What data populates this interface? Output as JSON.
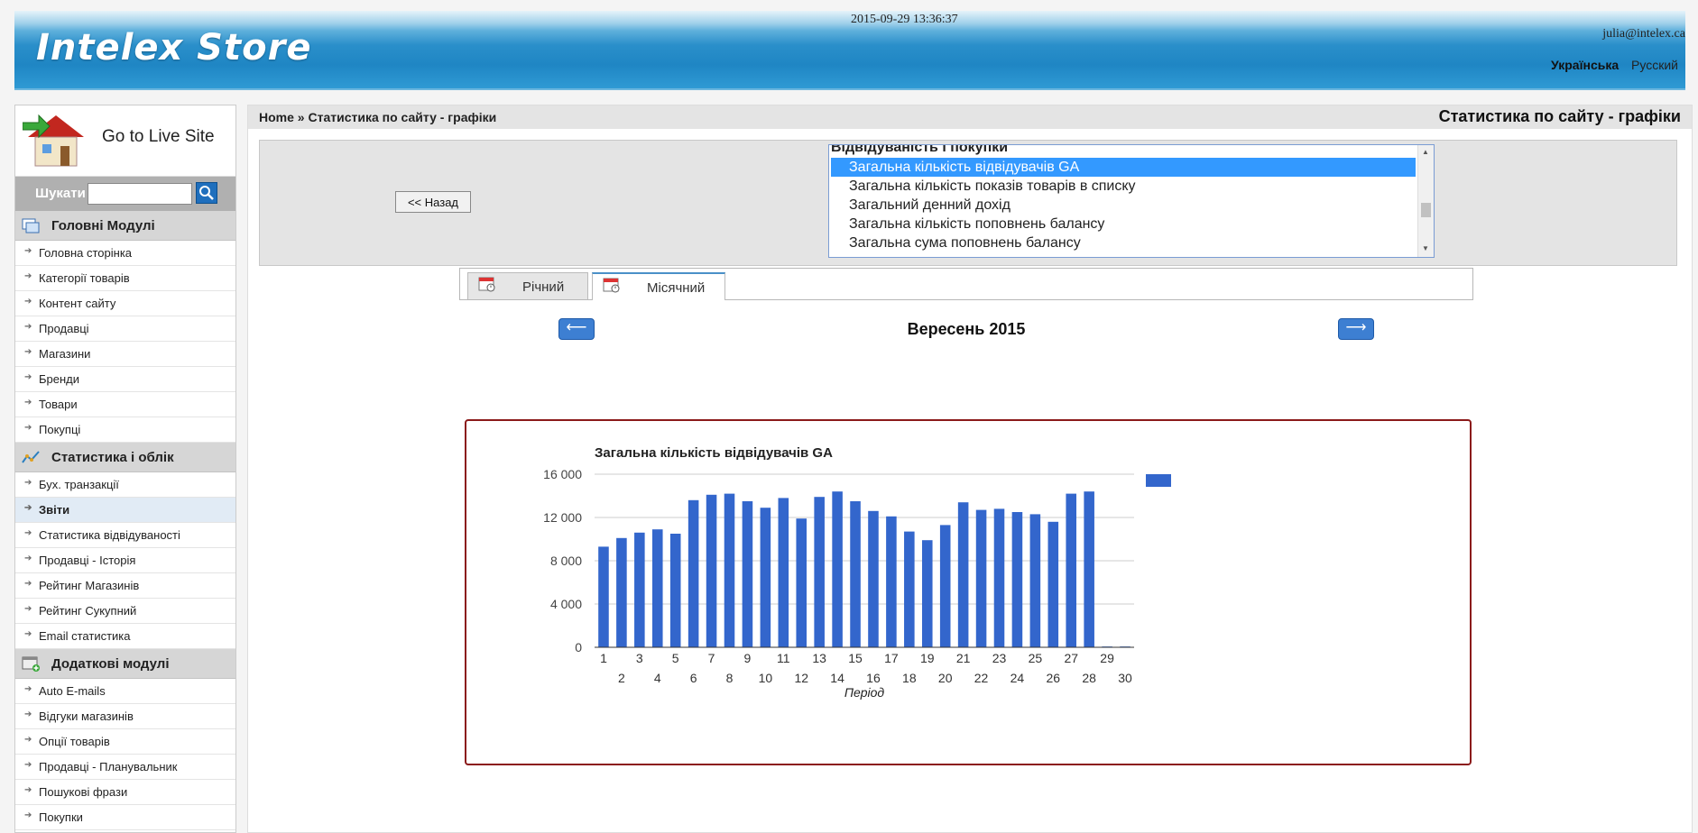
{
  "header": {
    "logo": "Intelex Store",
    "datetime": "2015-09-29 13:36:37",
    "user_email": "julia@intelex.ca",
    "languages": [
      "Українська",
      "Русский"
    ]
  },
  "sidebar": {
    "go_live": "Go to Live Site",
    "search_label": "Шукати",
    "search_value": "",
    "sections": [
      {
        "title": "Головні Модулі",
        "items": [
          "Головна сторінка",
          "Категорії товарів",
          "Контент сайту",
          "Продавці",
          "Магазини",
          "Бренди",
          "Товари",
          "Покупці"
        ]
      },
      {
        "title": "Статистика і облік",
        "items": [
          "Бух. транзакції",
          "Звіти",
          "Статистика відвідуваності",
          "Продавці - Історія",
          "Рейтинг Магазинів",
          "Рейтинг Сукупний",
          "Email статистика"
        ]
      },
      {
        "title": "Додаткові модулі",
        "items": [
          "Auto E-mails",
          "Відгуки магазинів",
          "Опції товарів",
          "Продавці - Планувальник",
          "Пошукові фрази",
          "Покупки"
        ]
      }
    ],
    "active_item": "Звіти"
  },
  "breadcrumb": {
    "home": "Home",
    "separator": "»",
    "current": "Статистика по сайту - графіки"
  },
  "page_title": "Статистика по сайту - графіки",
  "back_button": "<< Назад",
  "metric_list": {
    "group": "Відвідуваність і покупки",
    "options": [
      "Загальна кількість відвідувачів GA",
      "Загальна кількість показів товарів в списку",
      "Загальний денний дохід",
      "Загальна кількість поповнень балансу",
      "Загальна сума поповнень балансу"
    ],
    "selected": "Загальна кількість відвідувачів GA"
  },
  "tabs": [
    {
      "label": "Річний",
      "active": false
    },
    {
      "label": "Місячний",
      "active": true
    }
  ],
  "period_title": "Вересень 2015",
  "colors": {
    "bar": "#3366cc",
    "chart_border": "#8b1a1a",
    "selected_option": "#3399ff"
  },
  "chart_data": {
    "type": "bar",
    "title": "Загальна кількість відвідувачів GA",
    "xlabel": "Період",
    "ylabel": "",
    "ylim": [
      0,
      16000
    ],
    "yticks": [
      0,
      4000,
      8000,
      12000,
      16000
    ],
    "ytick_labels": [
      "0",
      "4 000",
      "8 000",
      "12 000",
      "16 000"
    ],
    "categories": [
      "1",
      "2",
      "3",
      "4",
      "5",
      "6",
      "7",
      "8",
      "9",
      "10",
      "11",
      "12",
      "13",
      "14",
      "15",
      "16",
      "17",
      "18",
      "19",
      "20",
      "21",
      "22",
      "23",
      "24",
      "25",
      "26",
      "27",
      "28",
      "29",
      "30"
    ],
    "series": [
      {
        "values": [
          9300,
          10100,
          10600,
          10900,
          10500,
          13600,
          14100,
          14200,
          13500,
          12900,
          13800,
          11900,
          13900,
          14400,
          13500,
          12600,
          12100,
          10700,
          9900,
          11300,
          13400,
          12700,
          12800,
          12500,
          12300,
          11600,
          14200,
          14400,
          0,
          0
        ]
      }
    ],
    "legend": "right",
    "grid": true
  }
}
